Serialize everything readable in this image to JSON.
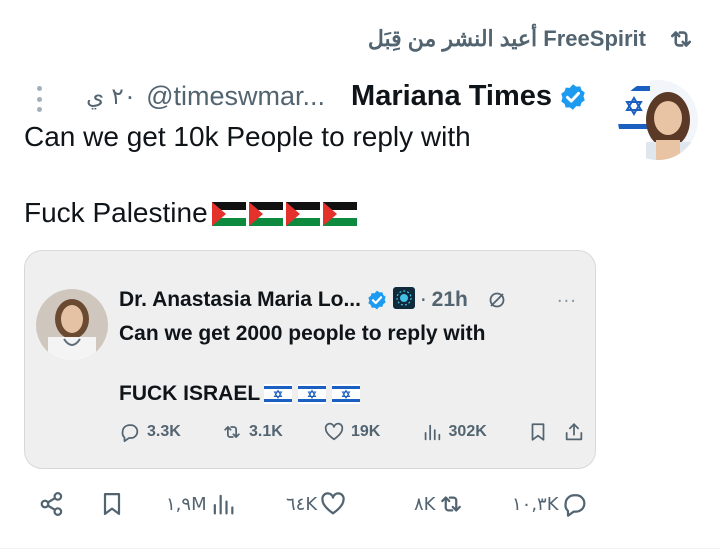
{
  "repost": {
    "text": "أعيد النشر من قِبَل FreeSpirit",
    "icon": "repost-icon"
  },
  "tweet": {
    "author_name": "Mariana Times",
    "handle": "@timeswmar...",
    "time": "٢٠ ي",
    "text": "Can we get 10k People to reply with\n\nFuck Palestine",
    "emoji": [
      "palestine-flag",
      "palestine-flag",
      "palestine-flag",
      "palestine-flag"
    ],
    "verified_color": "#1d9bf0"
  },
  "quote": {
    "author_name": "Dr. Anastasia Maria Lo...",
    "separator": "·",
    "time": "21h",
    "more": "···",
    "text": "Can we get 2000 people to reply with\n\nFUCK ISRAEL",
    "emoji": [
      "israel-flag",
      "israel-flag",
      "israel-flag"
    ],
    "stats": {
      "replies": "3.3K",
      "reposts": "3.1K",
      "likes": "19K",
      "views": "302K"
    }
  },
  "actions": {
    "replies": "١٠,٣K",
    "reposts": "٨K",
    "likes": "٦٤K",
    "views": "١,٩M"
  },
  "colors": {
    "secondary_text": "#536471",
    "quote_bg": "#efefef",
    "brand": "#1d9bf0"
  }
}
